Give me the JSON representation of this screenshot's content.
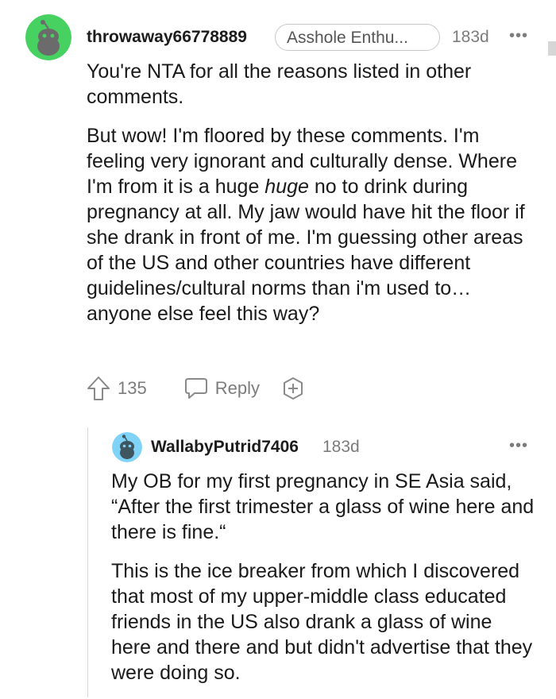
{
  "comments": [
    {
      "username": "throwaway66778889",
      "flair": "Asshole Enthu...",
      "age": "183d",
      "avatar_color": "#46d160",
      "paragraphs": [
        "You're NTA for all the reasons listed in other comments.",
        "But wow! I'm floored by these comments. I'm feeling very ignorant and culturally dense. Where I'm from it is a huge huge no to drink during pregnancy at all. My jaw would have hit the floor if she drank in front of me. I'm guessing other areas of the US and other countries have different guidelines/cultural norms than i'm used to… anyone else feel this way?"
      ],
      "p2_part1": "But wow! I'm floored by these comments. I'm feeling very ignorant and culturally dense. Where I'm from it is a huge ",
      "p2_emph": "huge",
      "p2_part2": " no to drink during pregnancy at all. My jaw would have hit the floor if she drank in front of me. I'm guessing other areas of the US and other countries have different guidelines/cultural norms than i'm used to… anyone else feel this way?",
      "votes": "135",
      "reply_label": "Reply",
      "icons": [
        "upvote-icon",
        "reply-icon",
        "award-icon",
        "more-options-icon"
      ]
    },
    {
      "username": "WallabyPutrid7406",
      "age": "183d",
      "avatar_color": "#7fd3f7",
      "paragraphs": [
        "My OB for my first pregnancy in SE Asia said, “After the first trimester a glass of wine here and there is fine.“",
        "This is the ice breaker from which I discovered that most of my upper-middle class educated friends in the US also drank a glass of wine here and there and but didn't advertise that they were doing so."
      ],
      "icons": [
        "more-options-icon"
      ]
    }
  ]
}
